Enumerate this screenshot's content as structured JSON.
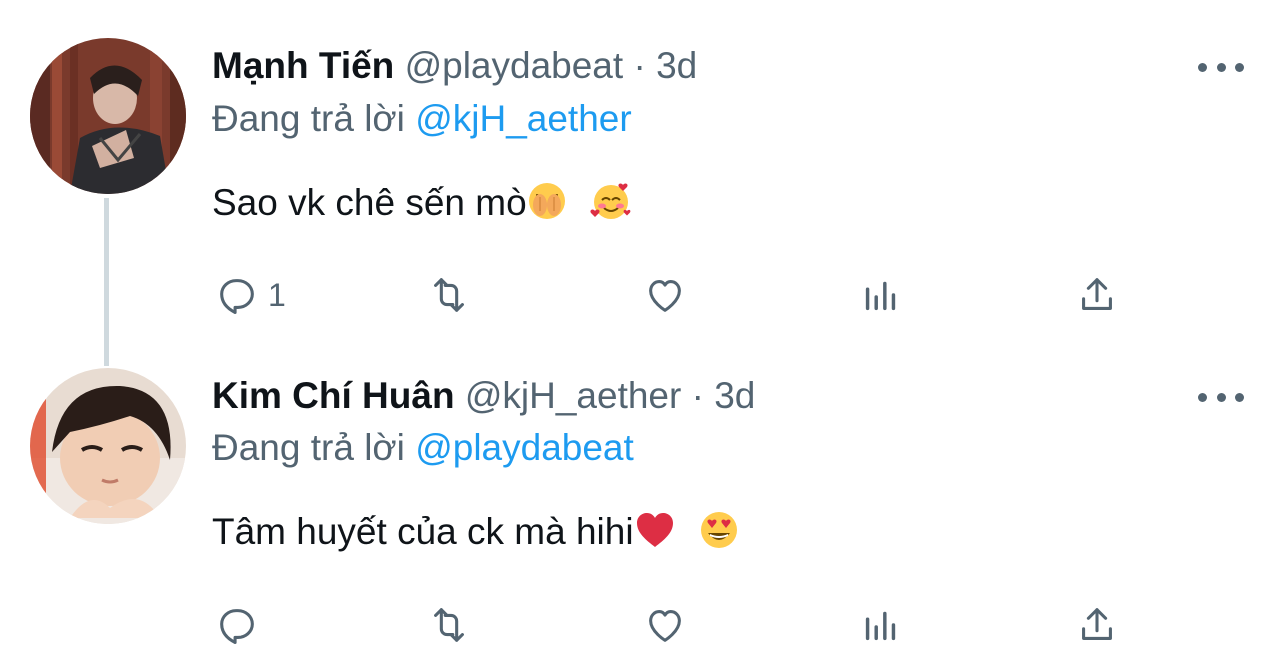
{
  "tweets": [
    {
      "name": "Mạnh Tiến",
      "handle": "@playdabeat",
      "separator": "·",
      "time": "3d",
      "replying_prefix": "Đang trả lời",
      "replying_to": "@kjH_aether",
      "text": "Sao vk chê sến mò",
      "emojis": [
        "face-with-hand-over-mouth-emoji",
        "smiling-face-with-hearts-emoji"
      ],
      "reply_count": "1"
    },
    {
      "name": "Kim Chí Huân",
      "handle": "@kjH_aether",
      "separator": "·",
      "time": "3d",
      "replying_prefix": "Đang trả lời",
      "replying_to": "@playdabeat",
      "text": "Tâm huyết của ck mà hihi",
      "emojis": [
        "red-heart-emoji",
        "heart-eyes-emoji"
      ],
      "reply_count": ""
    }
  ],
  "icons": [
    "reply-icon",
    "retweet-icon",
    "like-icon",
    "analytics-icon",
    "share-icon",
    "more-icon"
  ],
  "colors": {
    "link": "#1d9bf0",
    "secondary": "#536471",
    "text": "#0f1419",
    "thread_line": "#cfd9de"
  }
}
